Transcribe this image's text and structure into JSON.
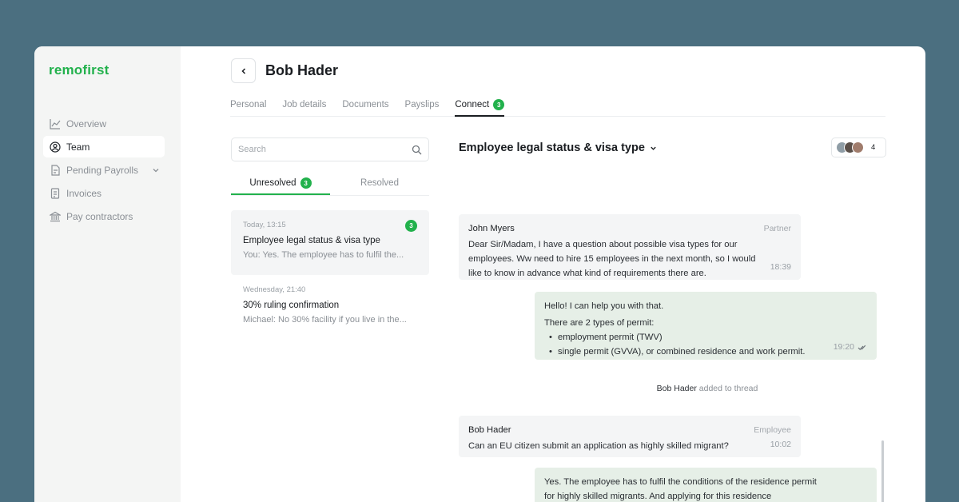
{
  "app": {
    "logo": "remofirst"
  },
  "sidebar": {
    "items": [
      {
        "label": "Overview",
        "icon": "chart-icon"
      },
      {
        "label": "Team",
        "icon": "user-icon",
        "active": true
      },
      {
        "label": "Pending Payrolls",
        "icon": "document-icon",
        "has_dropdown": true
      },
      {
        "label": "Invoices",
        "icon": "invoice-icon"
      },
      {
        "label": "Pay contractors",
        "icon": "bank-icon"
      }
    ]
  },
  "header": {
    "title": "Bob Hader"
  },
  "tabs": [
    {
      "label": "Personal"
    },
    {
      "label": "Job details"
    },
    {
      "label": "Documents"
    },
    {
      "label": "Payslips"
    },
    {
      "label": "Connect",
      "badge": "3",
      "active": true
    }
  ],
  "search": {
    "placeholder": "Search"
  },
  "subtabs": [
    {
      "label": "Unresolved",
      "badge": "3",
      "active": true
    },
    {
      "label": "Resolved"
    }
  ],
  "threads": [
    {
      "time": "Today, 13:15",
      "title": "Employee legal status & visa type",
      "preview": "You: Yes. The employee has to fulfil the...",
      "badge": "3"
    },
    {
      "time": "Wednesday, 21:40",
      "title": "30% ruling confirmation",
      "preview": "Michael: No 30% facility if you live in the..."
    }
  ],
  "conversation": {
    "title": "Employee legal status & visa type",
    "participants_count": "4",
    "messages": [
      {
        "author": "John Myers",
        "role": "Partner",
        "text": "Dear Sir/Madam, I have a question about possible visa types for our employees. Ww need to hire 15 employees in the next month, so I would like to know in advance what kind of requirements there are.",
        "time": "18:39"
      },
      {
        "line1": "Hello! I can help you with that.",
        "line2": "There are 2 types of permit:",
        "bullets": [
          "employment permit (TWV)",
          "single permit (GVVA), or combined residence and work permit."
        ],
        "time": "19:20"
      },
      {
        "system_name": "Bob Hader",
        "system_text": "added to thread"
      },
      {
        "author": "Bob Hader",
        "role": "Employee",
        "text": "Can an EU citizen submit an application as highly skilled migrant?",
        "time": "10:02"
      },
      {
        "text": "Yes. The employee has to fulfil the conditions of the residence permit for highly skilled migrants. And applying for this residence"
      }
    ]
  },
  "colors": {
    "accent": "#22b14c",
    "background": "#4b6f80",
    "out_bubble": "#e6efe7"
  }
}
